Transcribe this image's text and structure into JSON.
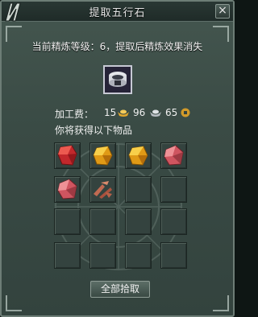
{
  "window": {
    "title": "提取五行石",
    "close_label": "×"
  },
  "info_text": "当前精炼等级：6，提取后精炼效果消失",
  "fee": {
    "label": "加工费：",
    "gold": "15",
    "silver": "96",
    "copper": "65"
  },
  "hint": "你将获得以下物品",
  "items": [
    {
      "name": "red-gem",
      "color": "#d4393a"
    },
    {
      "name": "yellow-gem",
      "color": "#e8a51d"
    },
    {
      "name": "yellow-gem",
      "color": "#e8a51d"
    },
    {
      "name": "pink-gem",
      "color": "#d9676d"
    },
    {
      "name": "pink-gem",
      "color": "#d9676d"
    },
    {
      "name": "shard-pile",
      "color": "#c8735a"
    }
  ],
  "collect_button": "全部拾取"
}
